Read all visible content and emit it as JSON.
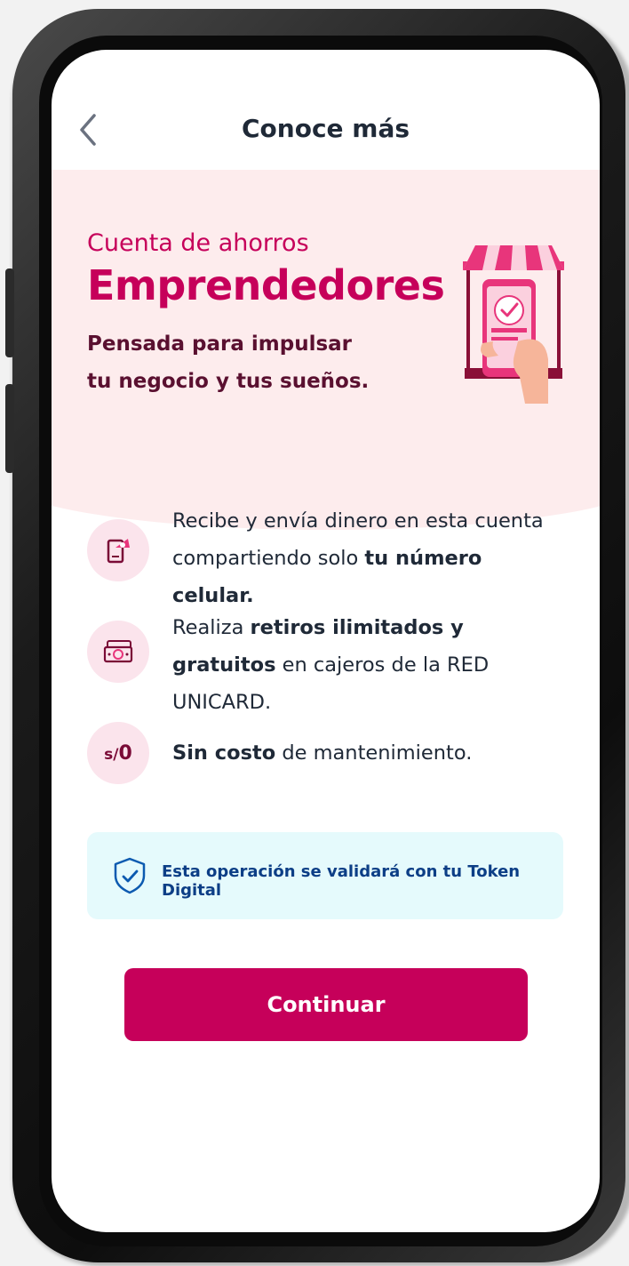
{
  "header": {
    "title": "Conoce más",
    "back_icon": "chevron-left-icon"
  },
  "hero": {
    "subtitle": "Cuenta de ahorros",
    "title": "Emprendedores",
    "description": "Pensada para impulsar tu negocio y tus sueños.",
    "illustration": "phone-storefront-illustration"
  },
  "features": [
    {
      "icon": "phone-transfer-icon",
      "text_before": "Recibe y envía dinero en esta cuenta compartiendo solo ",
      "text_bold": "tu número celular.",
      "text_after": ""
    },
    {
      "icon": "cash-icon",
      "text_before": "Realiza ",
      "text_bold": "retiros ilimitados y gratuitos",
      "text_after": " en cajeros de la RED UNICARD."
    },
    {
      "icon_symbol": "s/",
      "icon_value": "0",
      "text_before": "",
      "text_bold": "Sin costo",
      "text_after": " de mantenimiento."
    }
  ],
  "token": {
    "icon": "shield-check-icon",
    "text": "Esta operación se validará con tu Token Digital"
  },
  "cta": {
    "label": "Continuar"
  },
  "colors": {
    "brand": "#c6005a",
    "hero_bg": "#fdeced",
    "token_bg": "#e5fafc",
    "token_text": "#0c3e86"
  }
}
